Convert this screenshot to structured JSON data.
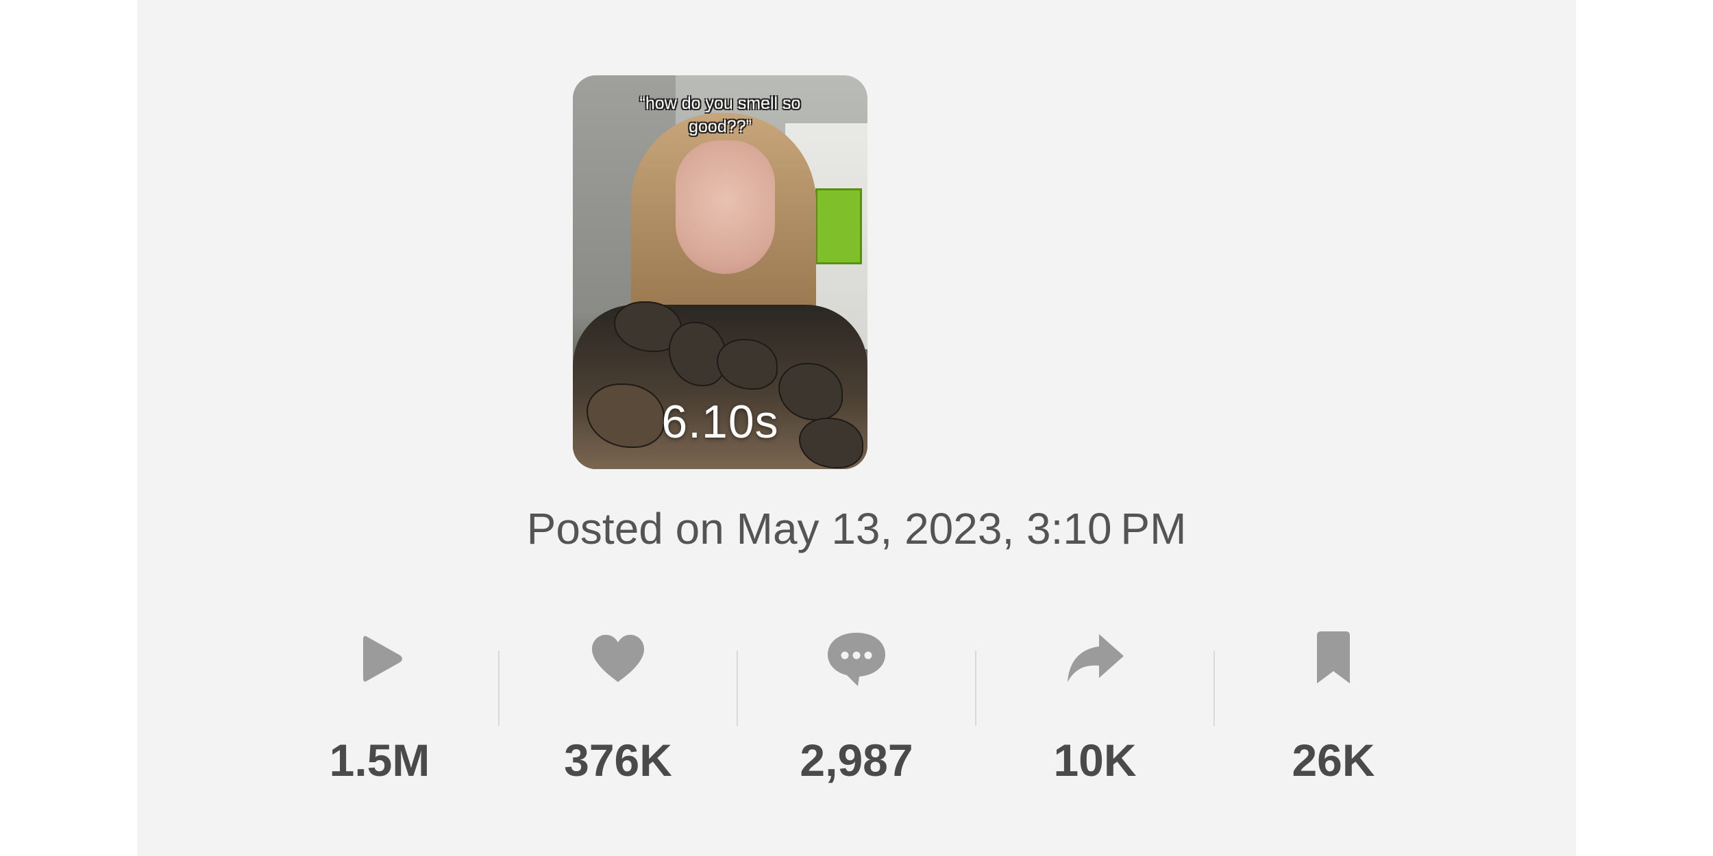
{
  "video": {
    "caption": "“how do you smell so good??”",
    "duration": "6.10s"
  },
  "posted_text": "Posted on May 13, 2023, 3:10 PM",
  "icon_color": "#9b9b9b",
  "stats": [
    {
      "icon": "play-icon",
      "value": "1.5M"
    },
    {
      "icon": "heart-icon",
      "value": "376K"
    },
    {
      "icon": "comment-icon",
      "value": "2,987"
    },
    {
      "icon": "share-icon",
      "value": "10K"
    },
    {
      "icon": "bookmark-icon",
      "value": "26K"
    }
  ]
}
